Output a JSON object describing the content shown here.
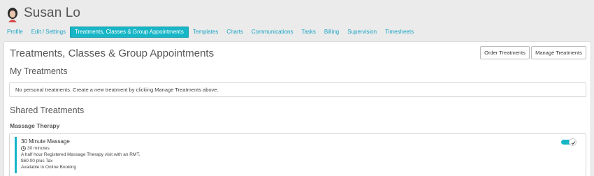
{
  "header": {
    "user_name": "Susan Lo"
  },
  "tabs": [
    {
      "label": "Profile",
      "active": false
    },
    {
      "label": "Edit / Settings",
      "active": false
    },
    {
      "label": "Treatments, Classes & Group Appointments",
      "active": true
    },
    {
      "label": "Templates",
      "active": false
    },
    {
      "label": "Charts",
      "active": false
    },
    {
      "label": "Communications",
      "active": false
    },
    {
      "label": "Tasks",
      "active": false
    },
    {
      "label": "Billing",
      "active": false
    },
    {
      "label": "Supervision",
      "active": false
    },
    {
      "label": "Timesheets",
      "active": false
    }
  ],
  "main": {
    "title": "Treatments, Classes & Group Appointments",
    "order_button": "Order Treatments",
    "manage_button": "Manage Treatments",
    "my_treatments": {
      "title": "My Treatments",
      "empty_message": "No personal treatments. Create a new treatment by clicking Manage Treatments above."
    },
    "shared_treatments": {
      "title": "Shared Treatments",
      "category": "Massage Therapy",
      "items": [
        {
          "name": "30 Minute Massage",
          "duration": "30 minutes",
          "description": "A half hour Registered Massage Therapy visit with an RMT.",
          "price": "$60.00 plus Tax",
          "booking": "Available in Online Booking",
          "enabled": true
        }
      ]
    }
  },
  "colors": {
    "accent": "#17b6c7",
    "link": "#1aa5c5",
    "background": "#ebebeb"
  },
  "icons": {
    "avatar": "user-avatar-icon",
    "clock": "clock-icon",
    "check": "check-icon"
  }
}
